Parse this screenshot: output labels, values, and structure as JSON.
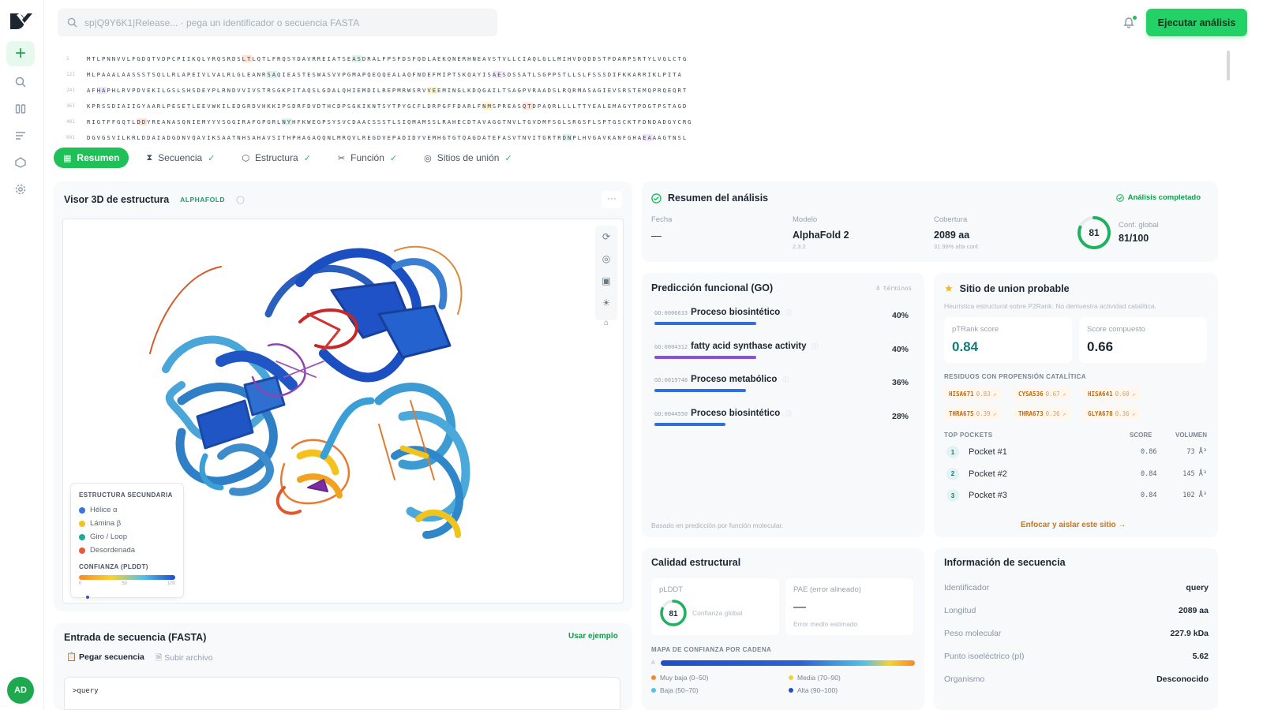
{
  "search": {
    "placeholder": "sp|Q9Y6K1|Release... · pega un identificador o secuencia FASTA"
  },
  "topbar": {
    "run_label": "Ejecutar análisis"
  },
  "sidebar": {
    "avatar": "AD"
  },
  "sequence": {
    "rows": [
      {
        "num": "1",
        "text": "MTLPNNVVLFGDQTVDPCPIIKQLYRQSRDSLTLQTLFRQSYDAVRREIATSEASDRALFPSFDSFQDLAEKQNERHNEAVSTVLLCIAQLGLLMIHVDQDDSTFDARPSRTYLVGLCTG"
      },
      {
        "num": "121",
        "text": "MLPAAALAASSSTSQLLRLAPEIVLVALRLGLEANRSAQIEASTESWASVVPGMAPQEQQEALAQFNDEFMIPTSKQAYISAESDSSATLSGPPSTLLSLFSSSDIFKKARRIKLPITA"
      },
      {
        "num": "241",
        "text": "AFHAPHLRVPDVEKILGSLSHSDEYPLRNDVVIVSTRSGKPITAQSLGDALQHIEMDILREPMRWSRVVEEMINGLKDQGAILTSAGPVRAADSLRQRMASAGIEVSRSTEMQPRQEQRT"
      },
      {
        "num": "361",
        "text": "KPRSSDIAIIGYAARLPESETLEEVWKILEDGRDVHKKIPSDRFDVDTHCDPSGKIKNTSYTPYGCFLDRPGFFDARLFNMSPREASQTDPAQRLLLLTTYEALEMAGYTPDGTPSTAGD"
      },
      {
        "num": "481",
        "text": "RIGTFFGQTLDDYREANASQNIEMYYVSGGIRAFGPGRLNYHFKWEGPSYSVCDAACSSSTLSIQMAMSSLRAHECDTAVAGGTNVLTGVDMFSGLSRGSFLSPTGSCKTFDNDADGYCRG"
      },
      {
        "num": "601",
        "text": "DGVGSVILKRLDDAIADGDNVQAVIKSAATNHSAHAVSITHPHAGAQQNLMRQVLREGDVEPADIDYVEMHGTGTQAGDATEFASVTNVITGRTRDNPLHVGAVKANFGHAEAAAGTNSL"
      }
    ]
  },
  "tabs": [
    {
      "label": "Resumen",
      "active": true
    },
    {
      "label": "Secuencia"
    },
    {
      "label": "Estructura"
    },
    {
      "label": "Función"
    },
    {
      "label": "Sitios de unión"
    }
  ],
  "viewer": {
    "title": "Visor 3D de estructura",
    "badge": "ALPHAFOLD",
    "legend_title": "ESTRUCTURA SECUNDARIA",
    "legend": [
      {
        "label": "Hélice α",
        "color": "#3b74d9"
      },
      {
        "label": "Lámina β",
        "color": "#f2c21d"
      },
      {
        "label": "Giro / Loop",
        "color": "#1fa8a0"
      },
      {
        "label": "Desordenada",
        "color": "#e05d3d"
      }
    ],
    "conf_title": "CONFIANZA (PLDDT)",
    "conf_ticks": [
      "0",
      "50",
      "100"
    ]
  },
  "fasta": {
    "title": "Entrada de secuencia (FASTA)",
    "example_link": "Usar ejemplo",
    "paste_tab": "Pegar secuencia",
    "upload_tab": "Subir archivo",
    "content": ">query"
  },
  "summary": {
    "title": "Resumen del análisis",
    "status": "Análisis completado",
    "fecha_label": "Fecha",
    "fecha_value": "—",
    "modelo_label": "Modelo",
    "modelo_value": "AlphaFold 2",
    "modelo_version": "2.3.2",
    "cobertura_label": "Cobertura",
    "cobertura_value": "2089 aa",
    "cobertura_sub": "31.98% alta conf.",
    "conf_score": "81",
    "conf_fraction": 0.81,
    "conf_label": "Conf. global",
    "conf_value": "81/100"
  },
  "go": {
    "title": "Predicción funcional (GO)",
    "count": "4 términos",
    "items": [
      {
        "id": "GO:0006633",
        "name": "Proceso biosintético",
        "pct": "40%",
        "value": 0.4,
        "color": "#2f6fe0"
      },
      {
        "id": "GO:0004312",
        "name": "fatty acid synthase activity",
        "pct": "40%",
        "value": 0.4,
        "color": "#8a4fe0"
      },
      {
        "id": "GO:0019748",
        "name": "Proceso metabólico",
        "pct": "36%",
        "value": 0.36,
        "color": "#2f6fe0"
      },
      {
        "id": "GO:0044550",
        "name": "Proceso biosintético",
        "pct": "28%",
        "value": 0.28,
        "color": "#2f6fe0"
      }
    ],
    "footer": "Basado en predicción por función molecular."
  },
  "site": {
    "title": "Sitio de union probable",
    "subtitle": "Heurística estructural sobre P2Rank. No demuestra actividad catalítica.",
    "p2rank_label": "pTRank score",
    "p2rank_value": "0.84",
    "composite_label": "Score compuesto",
    "composite_value": "0.66",
    "residues_title": "RESIDUOS CON PROPENSIÓN CATALÍTICA",
    "residues": [
      {
        "name": "HISA671",
        "score": "0.83"
      },
      {
        "name": "CYSA536",
        "score": "0.67"
      },
      {
        "name": "HISA641",
        "score": "0.60"
      },
      {
        "name": "THRA675",
        "score": "0.39"
      },
      {
        "name": "THRA673",
        "score": "0.36"
      },
      {
        "name": "GLYA678",
        "score": "0.36"
      }
    ],
    "pockets_title": "TOP POCKETS",
    "score_header": "SCORE",
    "volume_header": "VOLUMEN",
    "pockets": [
      {
        "n": "1",
        "name": "Pocket #1",
        "score": "0.86",
        "vol": "73 Å³"
      },
      {
        "n": "2",
        "name": "Pocket #2",
        "score": "0.84",
        "vol": "145 Å³"
      },
      {
        "n": "3",
        "name": "Pocket #3",
        "score": "0.84",
        "vol": "102 Å³"
      }
    ],
    "focus_link": "Enfocar y aislar este sitio"
  },
  "quality": {
    "title": "Calidad estructural",
    "plddt_label": "pLDDT",
    "plddt_value": "81",
    "plddt_fraction": 0.81,
    "plddt_sub": "Confianza global",
    "pae_label": "PAE (error alineado)",
    "pae_value": "—",
    "pae_sub": "Error medio estimado",
    "map_title": "MAPA DE CONFIANZA POR CADENA",
    "chain": "A",
    "legend": [
      {
        "label": "Muy baja (0–50)",
        "color": "#f58a2a"
      },
      {
        "label": "Media (70–90)",
        "color": "#f7d22f"
      },
      {
        "label": "Baja (50–70)",
        "color": "#54c0e8"
      },
      {
        "label": "Alta (90–100)",
        "color": "#1e4ec8"
      }
    ]
  },
  "info": {
    "title": "Información de secuencia",
    "rows": [
      {
        "k": "Identificador",
        "v": "query"
      },
      {
        "k": "Longitud",
        "v": "2089 aa"
      },
      {
        "k": "Peso molecular",
        "v": "227.9 kDa"
      },
      {
        "k": "Punto isoeléctrico (pI)",
        "v": "5.62"
      },
      {
        "k": "Organismo",
        "v": "Desconocido"
      }
    ]
  }
}
